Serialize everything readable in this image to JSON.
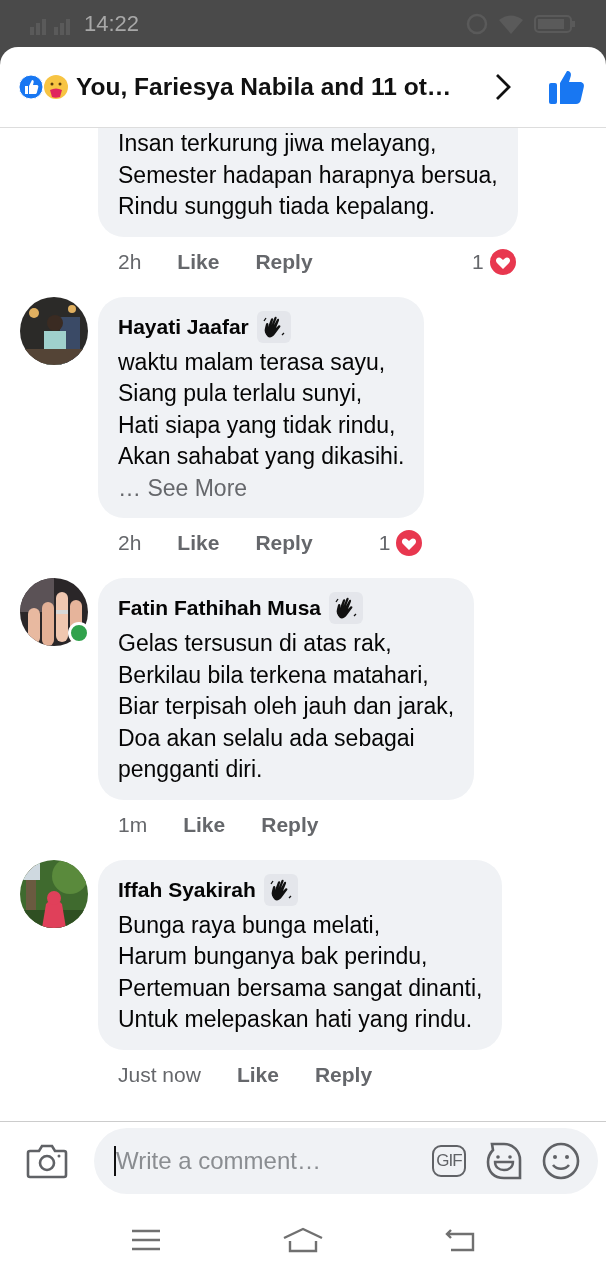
{
  "status_bar": {
    "time": "14:22"
  },
  "header": {
    "title": "You, Fariesya Nabila and 11 ot…"
  },
  "comments": [
    {
      "kind": "continued",
      "lines": [
        "Insan terkurung jiwa melayang,",
        "Semester hadapan harapnya bersua,",
        "Rindu sungguh tiada kepalang."
      ],
      "time": "2h",
      "like": "Like",
      "reply": "Reply",
      "reaction_count": "1"
    },
    {
      "kind": "full",
      "author": "Hayati Jaafar",
      "online": false,
      "lines": [
        "waktu malam terasa sayu,",
        "Siang pula terlalu sunyi,",
        "Hati siapa yang tidak rindu,",
        "Akan sahabat yang dikasihi."
      ],
      "see_more": "… See More",
      "time": "2h",
      "like": "Like",
      "reply": "Reply",
      "reaction_count": "1"
    },
    {
      "kind": "full",
      "author": "Fatin Fathihah Musa",
      "online": true,
      "lines": [
        "Gelas tersusun di atas rak,",
        "Berkilau bila terkena matahari,",
        "Biar terpisah oleh jauh dan jarak,",
        "Doa akan selalu ada sebagai",
        "pengganti diri."
      ],
      "time": "1m",
      "like": "Like",
      "reply": "Reply"
    },
    {
      "kind": "full",
      "author": "Iffah Syakirah",
      "online": false,
      "lines": [
        "Bunga raya bunga melati,",
        "Harum bunganya bak perindu,",
        "Pertemuan bersama sangat dinanti,",
        "Untuk melepaskan hati yang rindu."
      ],
      "time": "Just now",
      "like": "Like",
      "reply": "Reply"
    }
  ],
  "composer": {
    "placeholder": "Write a comment…",
    "gif": "GIF"
  }
}
